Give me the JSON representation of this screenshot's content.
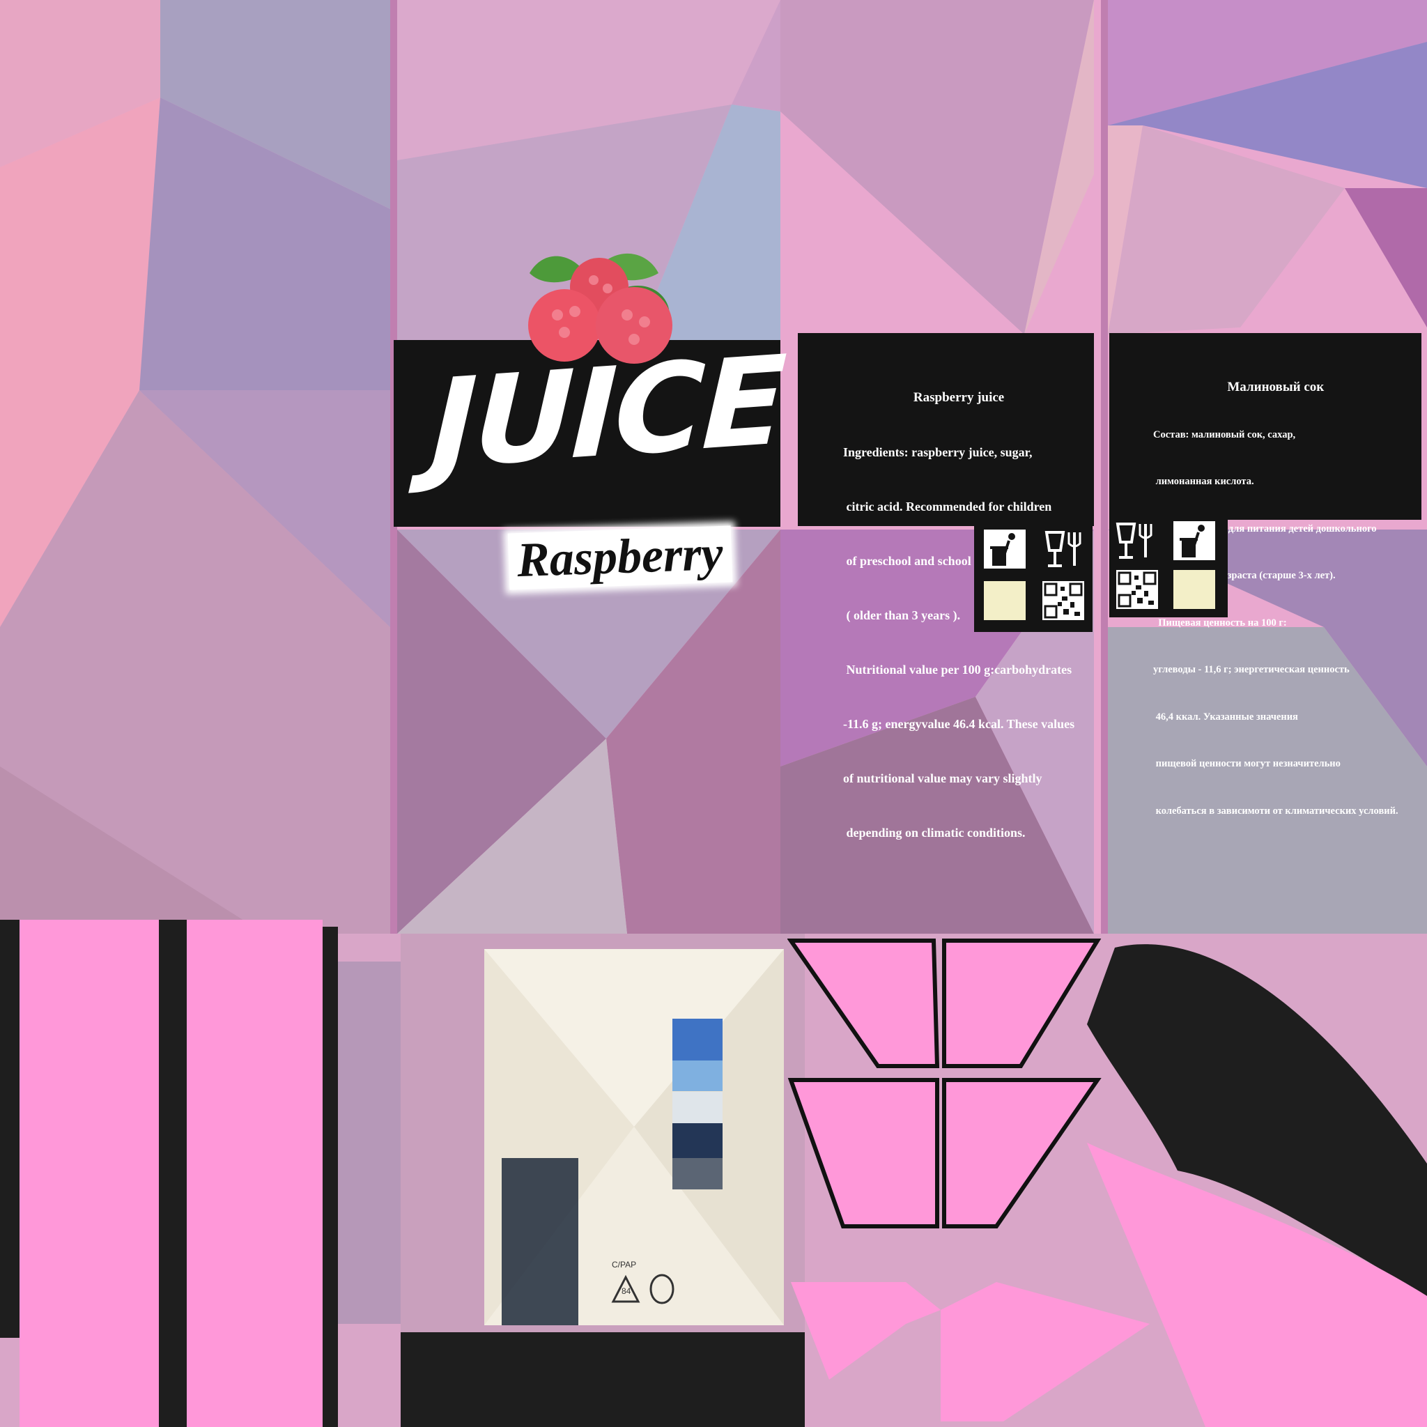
{
  "brand": {
    "name": "JUICE",
    "flavor": "Raspberry"
  },
  "front_icon": "raspberry-icon",
  "info_en": {
    "title": "Raspberry juice",
    "lines": [
      "Ingredients: raspberry juice, sugar,",
      " citric acid. Recommended for children",
      " of preschool and school age",
      " ( older than 3 years ).",
      " Nutritional value per 100 g:carbohydrates",
      "-11.6 g; energyvalue 46.4 kcal. These values",
      "of nutritional value may vary slightly",
      " depending on climatic conditions."
    ]
  },
  "info_ru": {
    "title": "Малиновый сок",
    "lines": [
      "Состав: малиновый сок, сахар,",
      " лимонанная кислота.",
      "  Рекомендуется для питания детей дошкольного",
      " и школьного возраста (старше 3-х лет).",
      "  Пищевая ценность на 100 г:",
      "углеводы - 11,6 г; энергетическая ценность",
      " 46,4 ккал. Указанные значения",
      " пищевой ценности могут незначительно",
      " колебаться в зависимоти от климатических условий."
    ]
  },
  "icons": [
    "trash-bin-icon",
    "glass-fork-icon",
    "photo-thumbnail-icon",
    "qr-code-icon"
  ],
  "recycle": {
    "code": "84",
    "label": "C/PAP"
  },
  "colors": {
    "band": "#141414",
    "pink": "#ff98d9",
    "text": "#ffffff",
    "dark": "#1e1e1e"
  }
}
